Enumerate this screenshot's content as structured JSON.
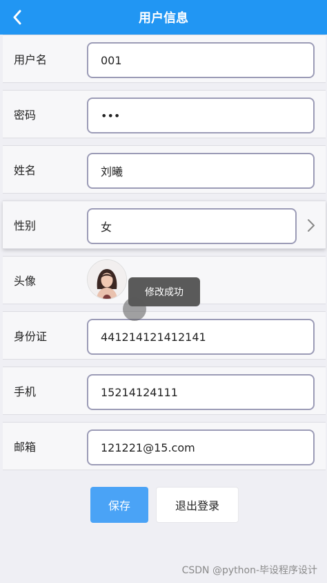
{
  "header": {
    "title": "用户信息",
    "back_icon": "chevron-left-icon"
  },
  "fields": [
    {
      "label": "用户名",
      "value": "001"
    },
    {
      "label": "密码",
      "value": "•••"
    },
    {
      "label": "姓名",
      "value": "刘曦"
    },
    {
      "label": "性别",
      "value": "女"
    },
    {
      "label": "头像"
    },
    {
      "label": "身份证",
      "value": "441214121412141"
    },
    {
      "label": "手机",
      "value": "15214124111"
    },
    {
      "label": "邮箱",
      "value": "121221@15.com"
    }
  ],
  "toast": {
    "text": "修改成功"
  },
  "buttons": {
    "save": "保存",
    "logout": "退出登录"
  },
  "watermark": "CSDN @python-毕设程序设计",
  "colors": {
    "header": "#2196f3",
    "save_button": "#4aa3f6"
  }
}
